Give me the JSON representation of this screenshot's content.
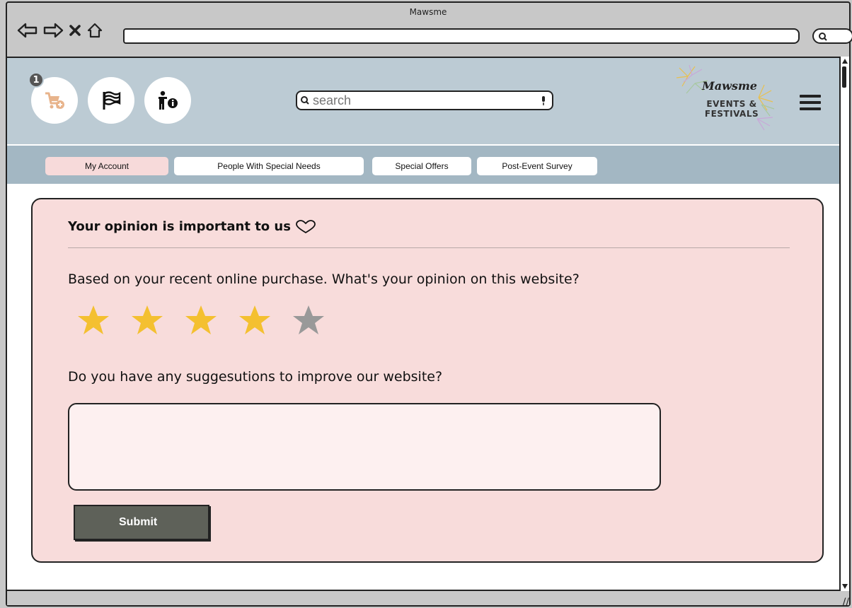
{
  "window": {
    "title": "Mawsme"
  },
  "header": {
    "cart_count": "1",
    "search": {
      "placeholder": "search"
    },
    "logo": {
      "script": "Mawsme",
      "line1": "EVENTS &",
      "line2": "FESTIVALS"
    }
  },
  "tabs": [
    {
      "label": "My Account",
      "active": true
    },
    {
      "label": "People With Special Needs",
      "active": false
    },
    {
      "label": "Special Offers",
      "active": false
    },
    {
      "label": "Post-Event Survey",
      "active": false
    }
  ],
  "survey": {
    "title": "Your opinion is important to us",
    "question1": "Based on your recent online purchase. What's your opinion on this website?",
    "rating": {
      "value": 4,
      "max": 5
    },
    "question2": "Do you have any suggesutions to improve our website?",
    "suggestion_value": "",
    "submit_label": "Submit"
  },
  "colors": {
    "header_bg": "#bccbd4",
    "tabbar_bg": "#a3b7c3",
    "active_tab": "#f7dada",
    "card_bg": "#f8dcdb",
    "star_filled": "#f4c030",
    "star_empty": "#999999",
    "submit_bg": "#5e6159"
  },
  "icons": {
    "cart": "cart-add-icon",
    "flag": "flag-icon",
    "accessibility": "accessibility-info-icon",
    "menu": "hamburger-menu-icon",
    "heart": "heart-outline-icon"
  }
}
